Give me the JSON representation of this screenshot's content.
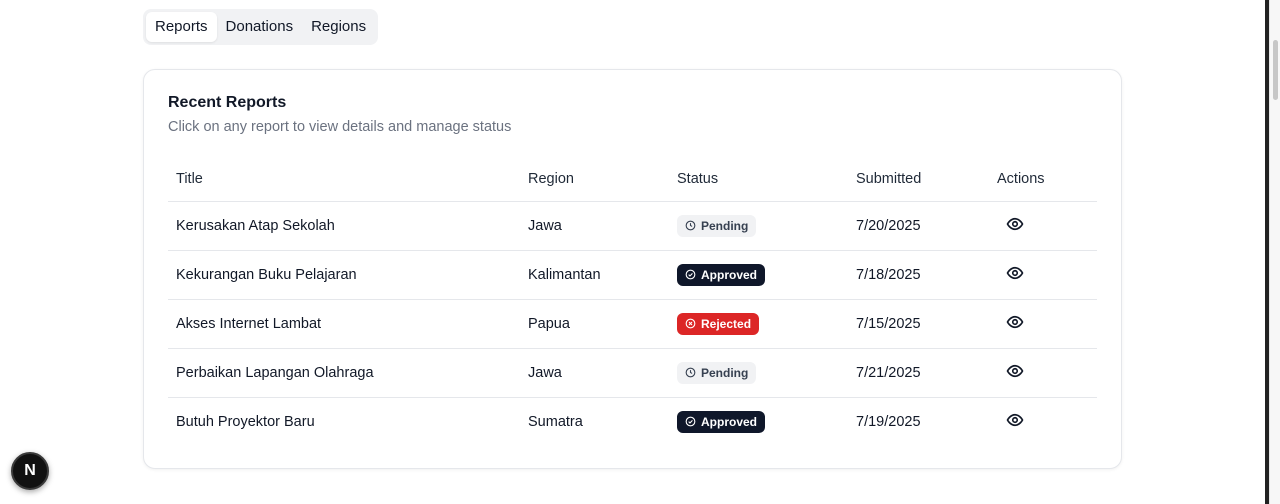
{
  "tabs": [
    {
      "label": "Reports",
      "active": true
    },
    {
      "label": "Donations",
      "active": false
    },
    {
      "label": "Regions",
      "active": false
    }
  ],
  "card": {
    "title": "Recent Reports",
    "description": "Click on any report to view details and manage status"
  },
  "table": {
    "headers": {
      "title": "Title",
      "region": "Region",
      "status": "Status",
      "submitted": "Submitted",
      "actions": "Actions"
    },
    "rows": [
      {
        "title": "Kerusakan Atap Sekolah",
        "region": "Jawa",
        "status": "Pending",
        "submitted": "7/20/2025"
      },
      {
        "title": "Kekurangan Buku Pelajaran",
        "region": "Kalimantan",
        "status": "Approved",
        "submitted": "7/18/2025"
      },
      {
        "title": "Akses Internet Lambat",
        "region": "Papua",
        "status": "Rejected",
        "submitted": "7/15/2025"
      },
      {
        "title": "Perbaikan Lapangan Olahraga",
        "region": "Jawa",
        "status": "Pending",
        "submitted": "7/21/2025"
      },
      {
        "title": "Butuh Proyektor Baru",
        "region": "Sumatra",
        "status": "Approved",
        "submitted": "7/19/2025"
      }
    ]
  },
  "icons": {
    "pending": "clock-icon",
    "approved": "check-circle-icon",
    "rejected": "x-circle-icon",
    "view": "eye-icon"
  },
  "colors": {
    "approved": "#0f172a",
    "rejected": "#dc2626",
    "pending": "#f1f2f4"
  },
  "dev_badge": {
    "letter": "N"
  }
}
